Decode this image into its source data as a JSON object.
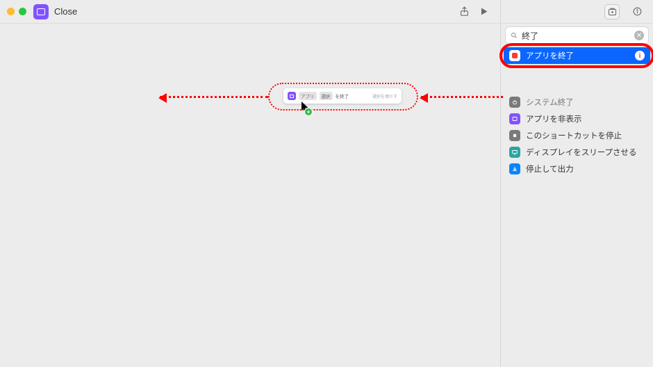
{
  "header": {
    "shortcut_name": "Close"
  },
  "canvas": {
    "action": {
      "prefix_pill": "アプリ",
      "var_pill": "選択",
      "suffix": "を終了",
      "hint": "選択を増やす"
    }
  },
  "panel": {
    "search_value": "終了",
    "actions": {
      "selected": {
        "label": "アプリを終了"
      },
      "truncated": {
        "label": "システム終了"
      },
      "items": [
        {
          "label": "アプリを非表示",
          "iconColor": "purple"
        },
        {
          "label": "このショートカットを停止",
          "iconColor": "gray"
        },
        {
          "label": "ディスプレイをスリープさせる",
          "iconColor": "teal"
        },
        {
          "label": "停止して出力",
          "iconColor": "blue"
        }
      ]
    }
  }
}
